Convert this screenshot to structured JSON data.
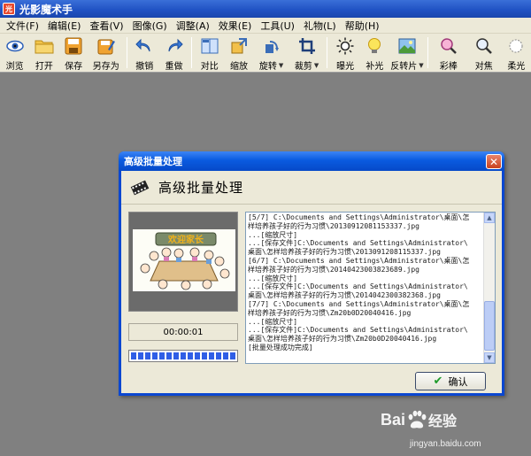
{
  "app": {
    "title": "光影魔术手",
    "icon_glyph": "光"
  },
  "menu": [
    "文件(F)",
    "编辑(E)",
    "查看(V)",
    "图像(G)",
    "调整(A)",
    "效果(E)",
    "工具(U)",
    "礼物(L)",
    "帮助(H)"
  ],
  "toolbar": {
    "browse": "浏览",
    "open": "打开",
    "save": "保存",
    "save_as": "另存为",
    "undo": "撤销",
    "redo": "重做",
    "compare": "对比",
    "resize": "缩放",
    "rotate": "旋转",
    "crop": "裁剪",
    "exposure": "曝光",
    "fill_light": "补光",
    "invert": "反转片",
    "color_pencil": "彩棒",
    "focus": "对焦",
    "soft": "柔光"
  },
  "dialog": {
    "title": "高级批量处理",
    "heading": "高级批量处理",
    "close_glyph": "✕",
    "preview_banner": "欢迎家长",
    "timer": "00:00:01",
    "progress_percent": 100,
    "ok_label": "确认",
    "log_lines": [
      "[5/7] C:\\Documents and Settings\\Administrator\\桌面\\怎",
      "样培养孩子好的行为习惯\\20130912081153337.jpg",
      "...[缩放尺寸]",
      "...[保存文件]C:\\Documents and Settings\\Administrator\\",
      "桌面\\怎样培养孩子好的行为习惯\\2013091208115337.jpg",
      "[6/7] C:\\Documents and Settings\\Administrator\\桌面\\怎",
      "样培养孩子好的行为习惯\\20140423003823689.jpg",
      "...[缩放尺寸]",
      "...[保存文件]C:\\Documents and Settings\\Administrator\\",
      "桌面\\怎样培养孩子好的行为习惯\\2014042300382368.jpg",
      "[7/7] C:\\Documents and Settings\\Administrator\\桌面\\怎",
      "样培养孩子好的行为习惯\\Zm20b0D20040416.jpg",
      "...[缩放尺寸]",
      "...[保存文件]C:\\Documents and Settings\\Administrator\\",
      "桌面\\怎样培养孩子好的行为习惯\\Zm20b0D20040416.jpg",
      "[批量处理成功完成]"
    ]
  },
  "watermark": {
    "brand_left": "Bai",
    "brand_right": "经验",
    "url": "jingyan.baidu.com"
  }
}
